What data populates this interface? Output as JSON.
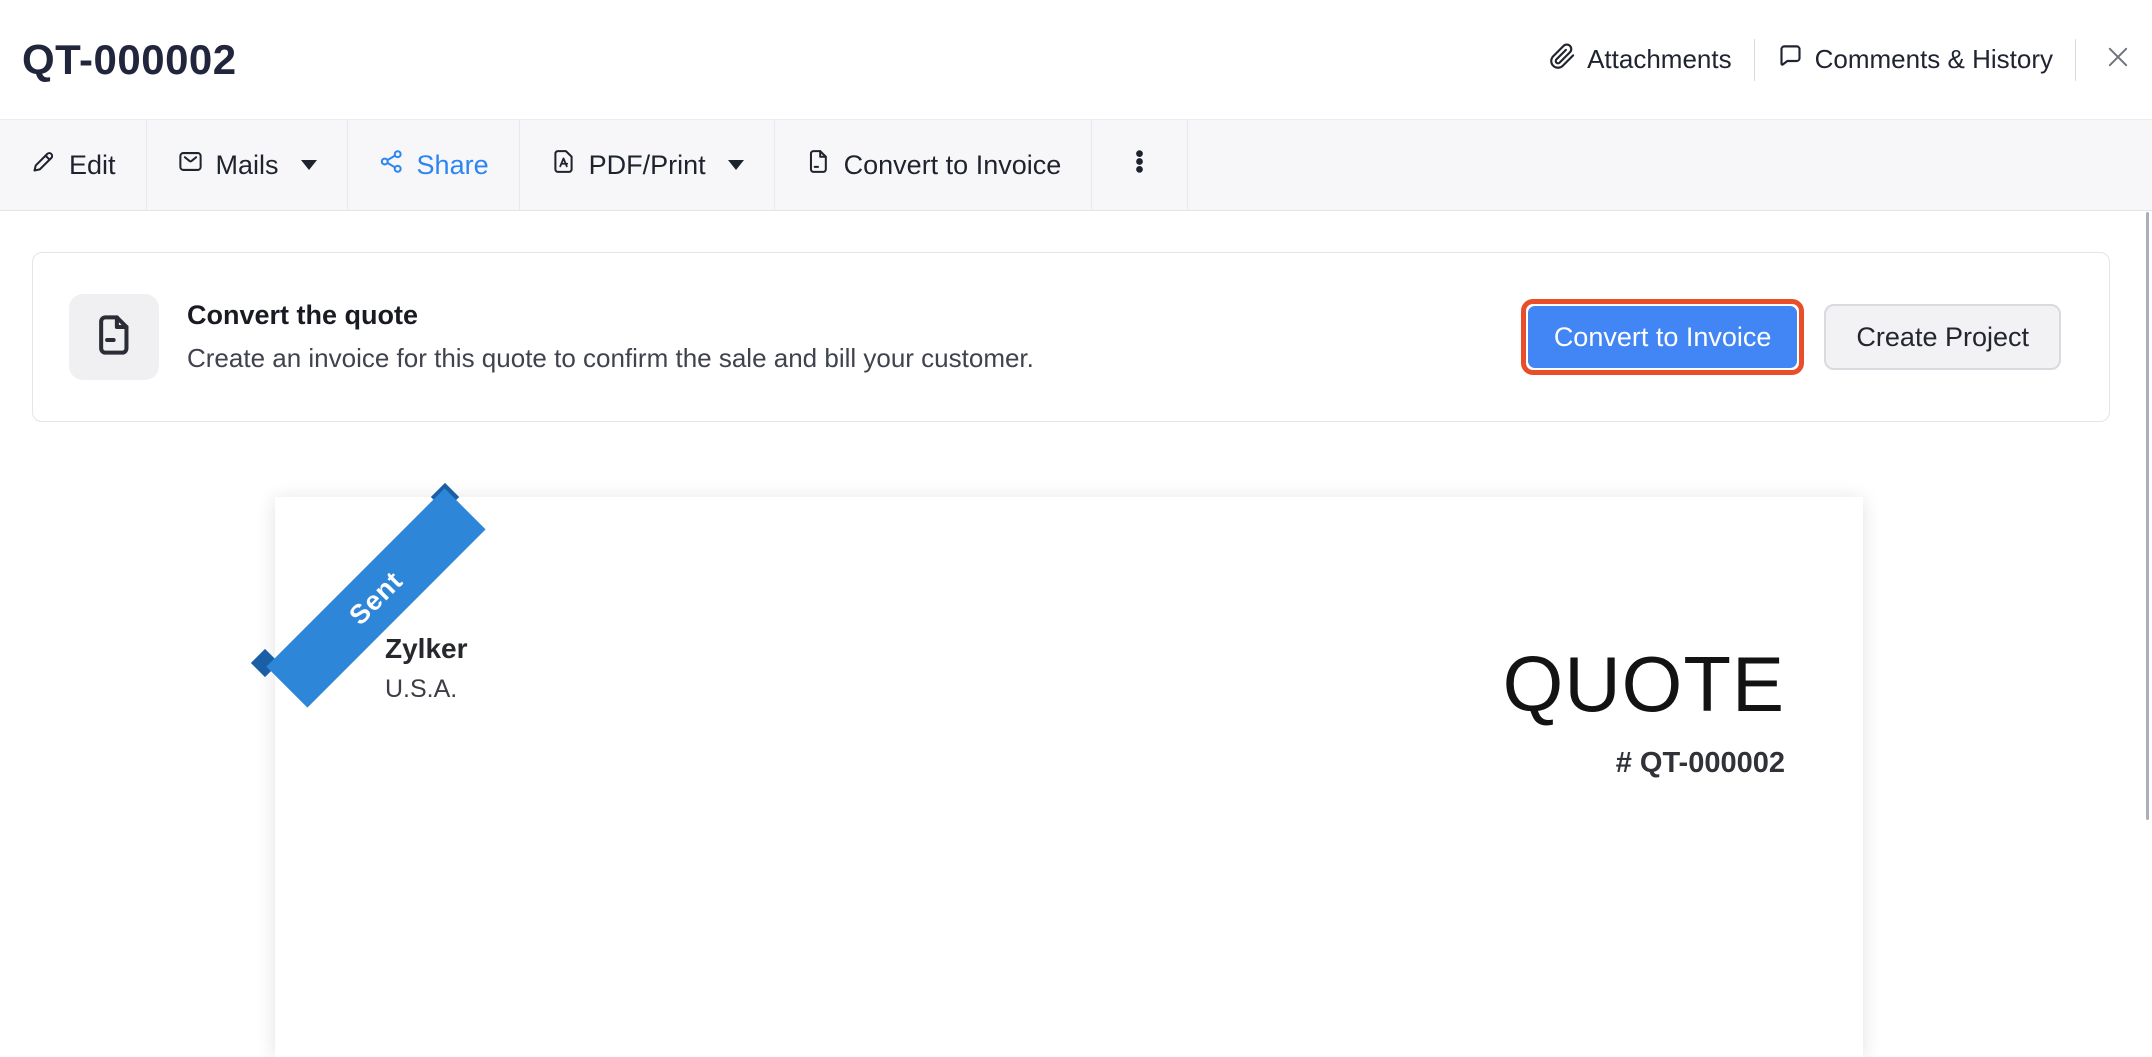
{
  "header": {
    "title": "QT-000002",
    "actions": [
      {
        "label": "Attachments",
        "icon": "paperclip-icon"
      },
      {
        "label": "Comments & History",
        "icon": "comment-icon"
      }
    ]
  },
  "toolbar": {
    "items": [
      {
        "label": "Edit",
        "icon": "pencil-icon",
        "has_caret": false
      },
      {
        "label": "Mails",
        "icon": "envelope-icon",
        "has_caret": true
      },
      {
        "label": "Share",
        "icon": "share-icon",
        "has_caret": false,
        "color": "#2b85f2"
      },
      {
        "label": "PDF/Print",
        "icon": "pdf-icon",
        "has_caret": true
      },
      {
        "label": "Convert to Invoice",
        "icon": "file-icon",
        "has_caret": false
      },
      {
        "label": "",
        "icon": "more-options-icon",
        "has_caret": false
      }
    ]
  },
  "callout": {
    "icon": "file-icon",
    "title": "Convert the quote",
    "description": "Create an invoice for this quote to confirm the sale and bill your customer.",
    "primary_button": "Convert to Invoice",
    "secondary_button": "Create Project"
  },
  "document": {
    "status_ribbon": "Sent",
    "company_name": "Zylker",
    "company_country": "U.S.A.",
    "doc_type": "QUOTE",
    "doc_number": "# QT-000002"
  },
  "colors": {
    "accent_blue": "#2b85f2",
    "primary_button_blue": "#4285f4",
    "highlight_orange": "#e84e29",
    "ribbon_blue": "#2e86d9",
    "ribbon_fold_blue": "#1a5fa6",
    "toolbar_bg": "#f7f7fa"
  }
}
